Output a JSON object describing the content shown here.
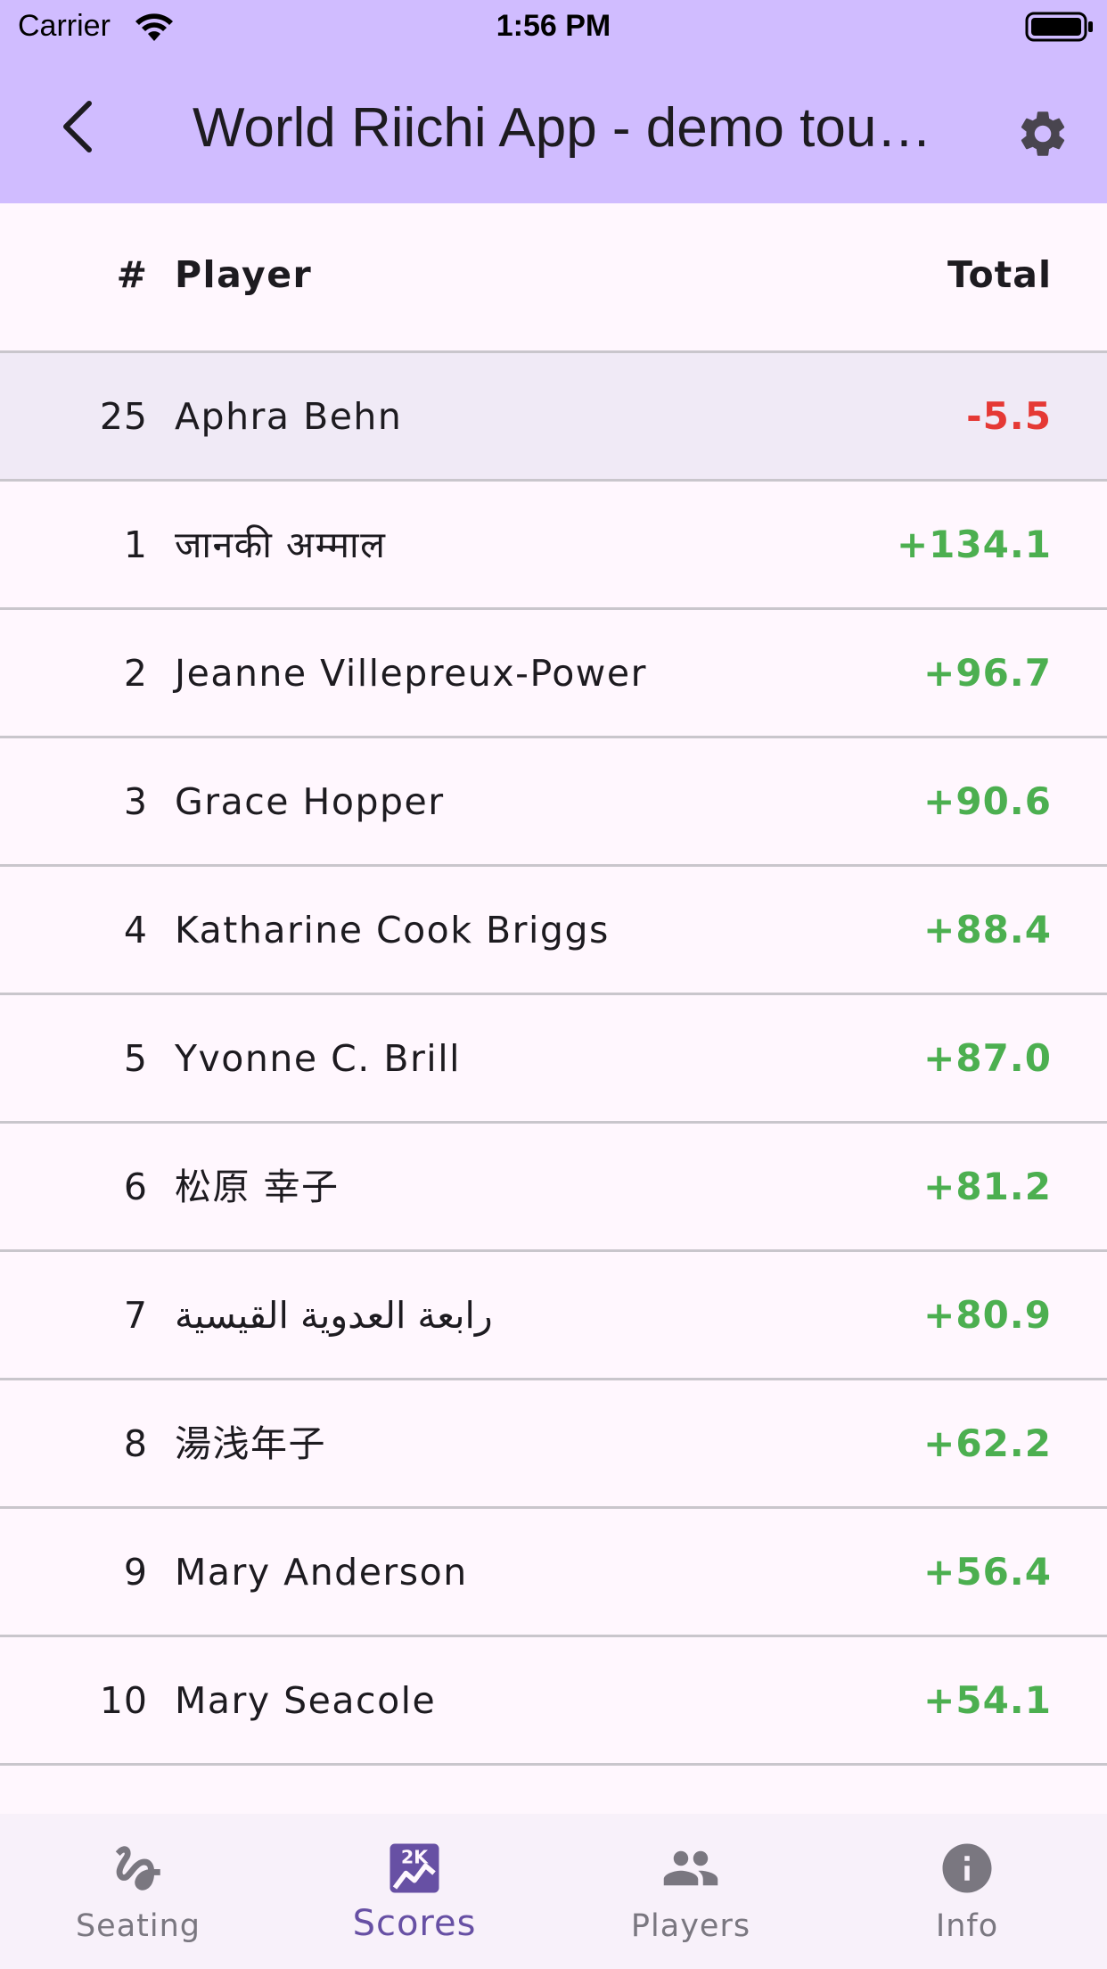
{
  "status_bar": {
    "carrier": "Carrier",
    "time": "1:56 PM"
  },
  "app_bar": {
    "title": "World Riichi App - demo tournament",
    "back_icon": "chevron-left-icon",
    "settings_icon": "gear-icon"
  },
  "table": {
    "headers": {
      "rank": "#",
      "player": "Player",
      "total": "Total"
    },
    "highlighted_row": {
      "rank": "25",
      "name": "Aphra Behn",
      "total": "-5.5"
    },
    "rows": [
      {
        "rank": "1",
        "name": "जानकी अम्माल",
        "total": "+134.1"
      },
      {
        "rank": "2",
        "name": "Jeanne Villepreux-Power",
        "total": "+96.7"
      },
      {
        "rank": "3",
        "name": "Grace Hopper",
        "total": "+90.6"
      },
      {
        "rank": "4",
        "name": "Katharine Cook Briggs",
        "total": "+88.4"
      },
      {
        "rank": "5",
        "name": "Yvonne C. Brill",
        "total": "+87.0"
      },
      {
        "rank": "6",
        "name": "松原 幸子",
        "total": "+81.2"
      },
      {
        "rank": "7",
        "name": "رابعة العدوية القيسية",
        "total": "+80.9"
      },
      {
        "rank": "8",
        "name": "湯浅年子",
        "total": "+62.2"
      },
      {
        "rank": "9",
        "name": "Mary Anderson",
        "total": "+56.4"
      },
      {
        "rank": "10",
        "name": "Mary Seacole",
        "total": "+54.1"
      }
    ]
  },
  "colors": {
    "app_bar": "#D0BCFF",
    "positive": "#4CAF50",
    "negative": "#E53935",
    "active_nav": "#6750A4"
  },
  "bottom_nav": {
    "items": [
      {
        "label": "Seating",
        "icon": "seat-icon",
        "active": false
      },
      {
        "label": "Scores",
        "icon": "scores-icon",
        "active": true
      },
      {
        "label": "Players",
        "icon": "people-icon",
        "active": false
      },
      {
        "label": "Info",
        "icon": "info-icon",
        "active": false
      }
    ]
  }
}
